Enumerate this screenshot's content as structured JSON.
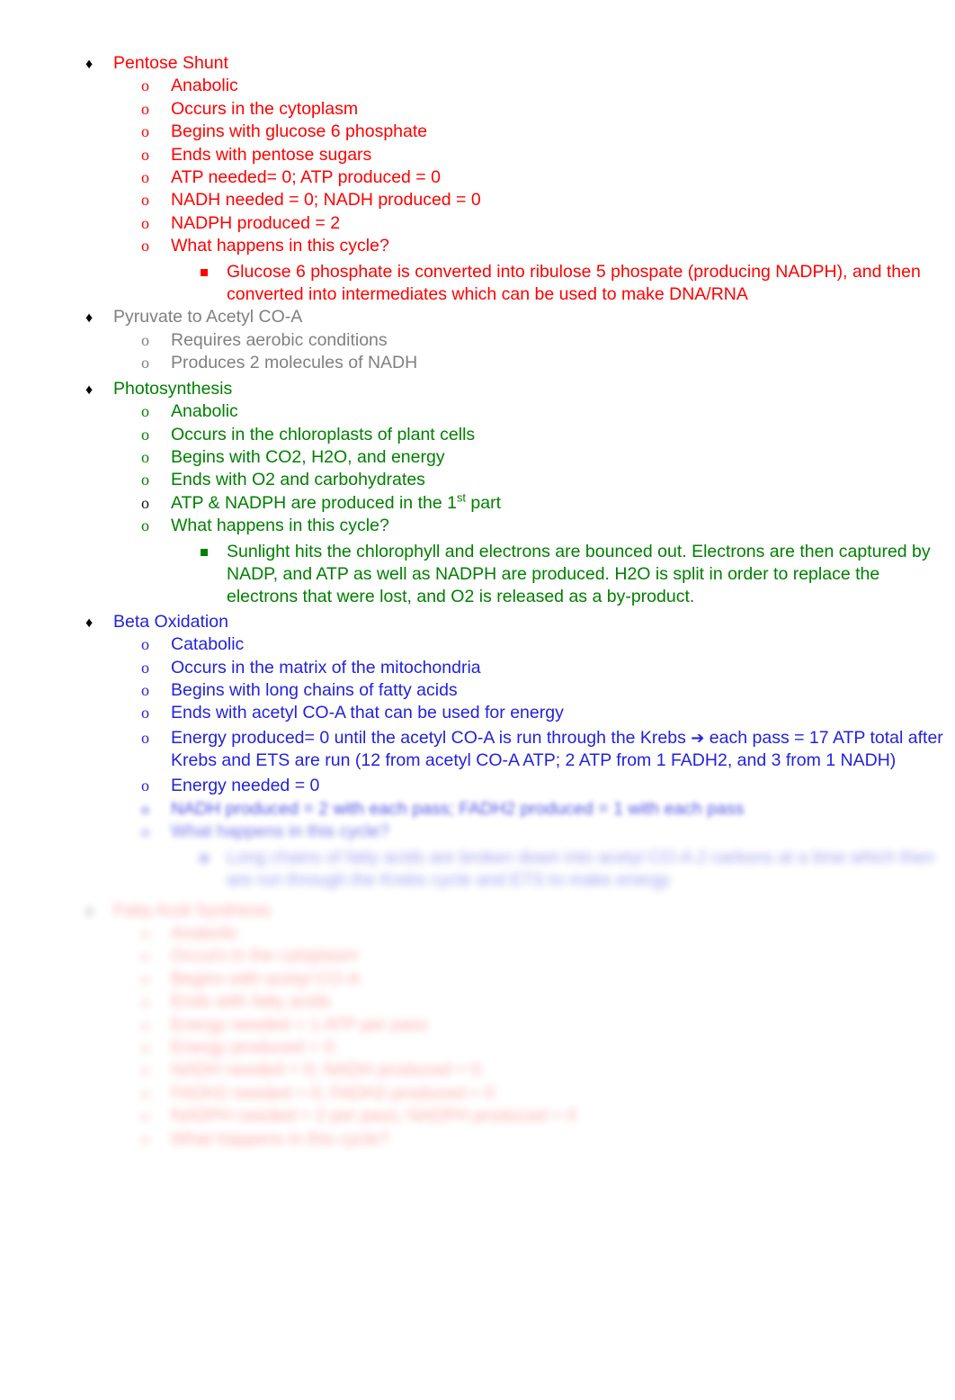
{
  "document": {
    "type": "study-notes-outline",
    "background": "#ffffff",
    "colors": {
      "red": "#FF0000",
      "gray": "#808080",
      "green": "#008000",
      "blue": "#2222DD",
      "bullet_black": "#000000"
    },
    "bullets": {
      "level1": "♦",
      "level2": "o",
      "level3": "▪"
    }
  },
  "sections": [
    {
      "heading": "Pentose Shunt",
      "color": "red",
      "items": [
        "Anabolic",
        "Occurs in the cytoplasm",
        "Begins with glucose 6 phosphate",
        "Ends with pentose sugars",
        "ATP needed= 0; ATP produced = 0",
        "NADH needed = 0; NADH produced = 0",
        "NADPH produced = 2",
        "What happens in this cycle?"
      ],
      "detail": "Glucose 6 phosphate is converted into ribulose 5 phospate (producing NADPH), and then converted into intermediates which can be used to make DNA/RNA"
    },
    {
      "heading": "Pyruvate to Acetyl CO-A",
      "color": "gray",
      "items": [
        "Requires aerobic conditions",
        "Produces 2 molecules of NADH"
      ]
    },
    {
      "heading": "Photosynthesis",
      "color": "green",
      "items": [
        "Anabolic",
        "Occurs in the chloroplasts of plant cells",
        "Begins with CO2, H2O, and energy",
        "Ends with O2 and carbohydrates",
        "ATP & NADPH are produced in the 1st part",
        "What happens in this cycle?"
      ],
      "item_atp_prefix": "ATP & NADPH are produced in the 1",
      "item_atp_sup": "st",
      "item_atp_suffix": " part",
      "detail": "Sunlight hits the chlorophyll and electrons are bounced out.  Electrons are then captured by NADP, and ATP as well as NADPH are produced.  H2O is split in order to replace the electrons that were lost, and O2 is released as a by-product."
    },
    {
      "heading": "Beta Oxidation",
      "color": "blue",
      "items": [
        "Catabolic",
        "Occurs in the matrix of the mitochondria",
        "Begins with long chains of fatty acids",
        "Ends with acetyl CO-A that can be used for energy"
      ],
      "energy_produced_part1": "Energy produced= 0 until the acetyl CO-A is run through the Krebs ",
      "energy_produced_arrow": "➔",
      "energy_produced_part2": " each pass = 17 ATP total after Krebs and ETS are run (12 from acetyl CO-A ATP; 2 ATP from 1 FADH2, and 3 from 1 NADH)",
      "energy_needed": "Energy needed = 0",
      "obscured_items": [
        "NADH produced = 2 with each pass; FADH2 produced = 1 with each pass",
        "What happens in this cycle?"
      ],
      "obscured_detail": "Long chains of fatty acids are broken down into acetyl CO-A 2 carbons at a time which then are run through the Krebs cycle and ETS to make energy"
    },
    {
      "heading": "Fatty Acid Synthesis",
      "color": "red",
      "obscured": true,
      "items": [
        "Anabolic",
        "Occurs in the cytoplasm",
        "Begins with acetyl CO-A",
        "Ends with fatty acids",
        "Energy needed = 1 ATP per pass",
        "Energy produced = 0",
        "NADH needed = 0; NADH produced = 0",
        "FADH2 needed = 0; FADH2 produced = 0",
        "NADPH needed = 2 per pass; NADPH produced = 0",
        "What happens in this cycle?"
      ]
    }
  ]
}
